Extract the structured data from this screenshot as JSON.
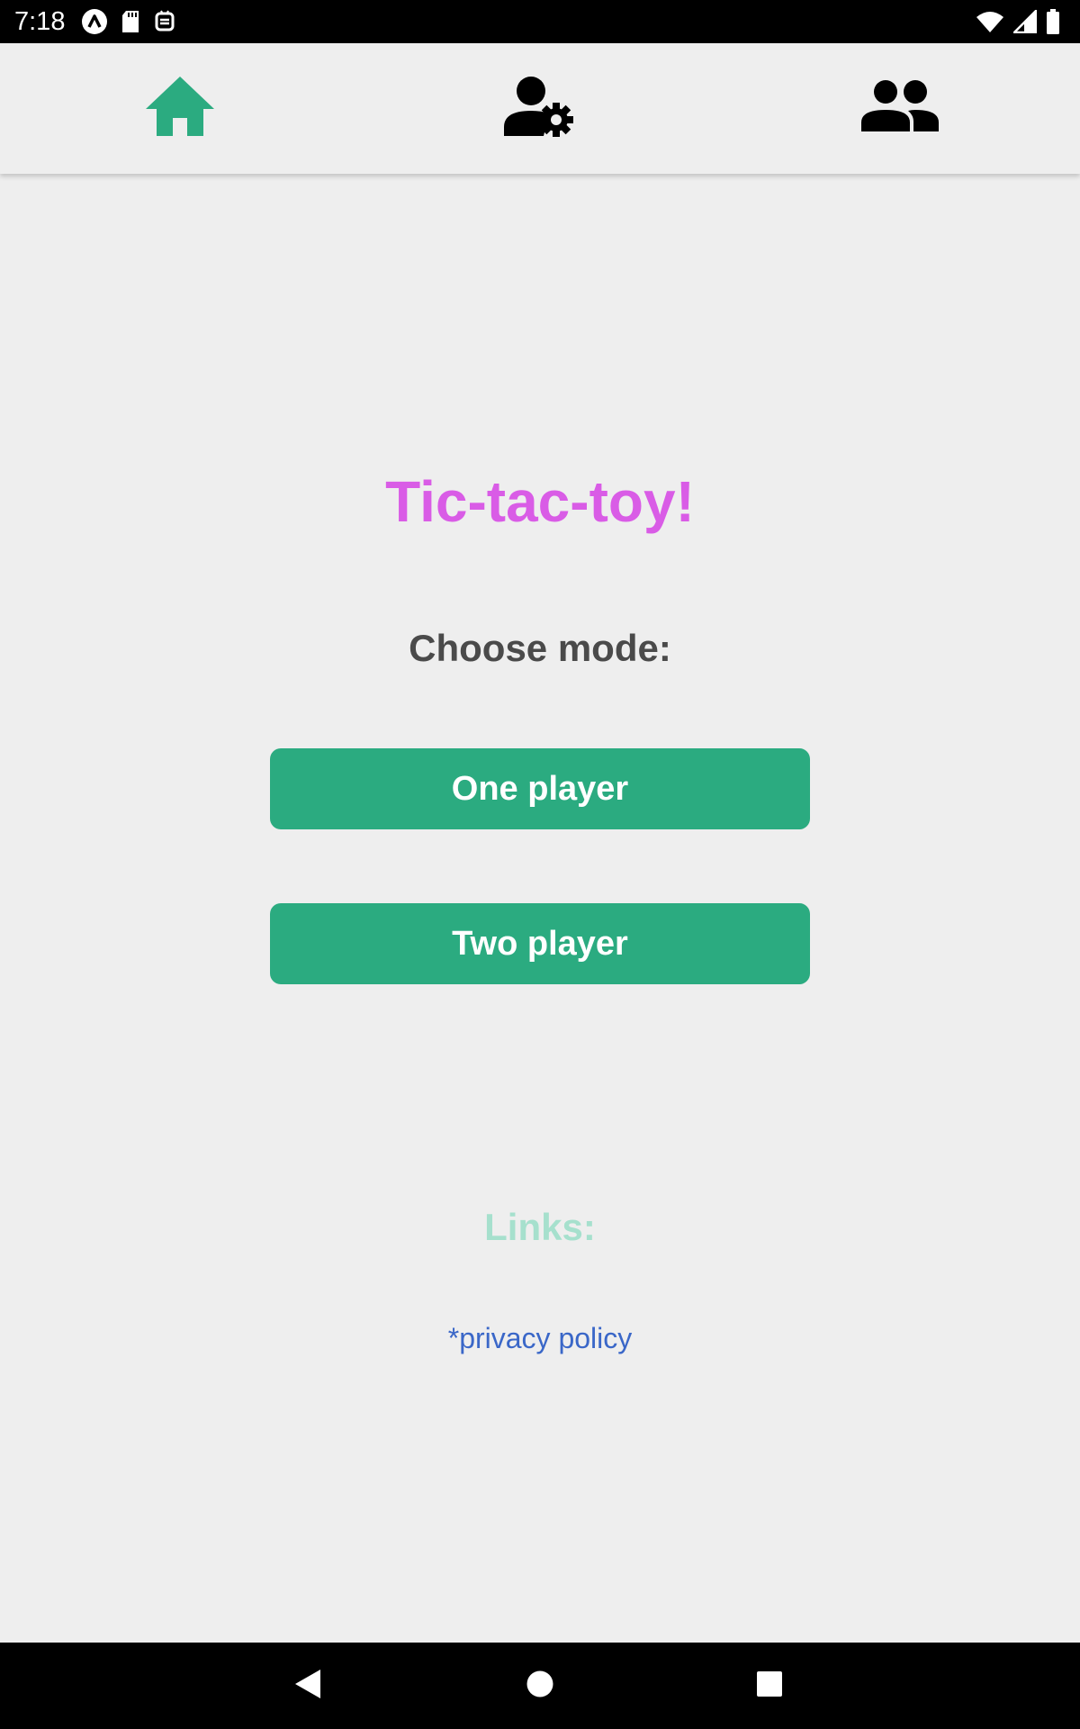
{
  "status_bar": {
    "time": "7:18",
    "icons": [
      "app-notification-icon",
      "sd-card-icon",
      "debug-icon",
      "wifi-icon",
      "cell-signal-icon",
      "battery-icon"
    ]
  },
  "top_nav": {
    "items": [
      {
        "name": "home",
        "icon": "home-icon",
        "active": true
      },
      {
        "name": "profile-settings",
        "icon": "user-settings-icon",
        "active": false
      },
      {
        "name": "friends",
        "icon": "people-icon",
        "active": false
      }
    ],
    "active_color": "#2bab80",
    "inactive_color": "#000000"
  },
  "main": {
    "title": "Tic-tac-toy!",
    "subtitle": "Choose mode:",
    "buttons": {
      "one_player": "One player",
      "two_player": "Two player"
    },
    "links_heading": "Links:",
    "privacy_link": "*privacy policy"
  },
  "colors": {
    "title": "#d95ce6",
    "button": "#2bab80",
    "links_heading": "#a6e0cd",
    "link": "#3a67c8",
    "background": "#eeeeee"
  },
  "system_nav": {
    "buttons": [
      "back-icon",
      "home-circle-icon",
      "recents-icon"
    ]
  }
}
